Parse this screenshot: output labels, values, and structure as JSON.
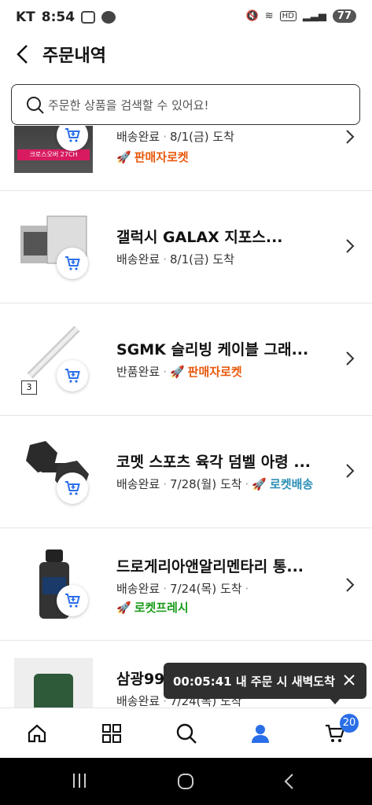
{
  "status_bar": {
    "carrier": "KT",
    "time": "8:54",
    "battery": "77"
  },
  "header": {
    "title": "주문내역"
  },
  "search": {
    "placeholder": "주문한 상품을 검색할 수 있어요!"
  },
  "orders": [
    {
      "name": "",
      "status": "배송완료",
      "date": "8/1(금) 도착",
      "delivery": "판매자로켓",
      "delivery_color": "orange",
      "thumb_text": "크로스오버 27CH"
    },
    {
      "name": "갤럭시 GALAX 지포스...",
      "status": "배송완료",
      "date": "8/1(금) 도착",
      "delivery": ""
    },
    {
      "name": "SGMK 슬리빙 케이블 그래...",
      "status": "반품완료",
      "date": "",
      "delivery": "판매자로켓",
      "delivery_color": "orange",
      "qty": "3"
    },
    {
      "name": "코멧 스포츠 육각 덤벨 아령 ...",
      "status": "배송완료",
      "date": "7/28(월) 도착",
      "delivery": "로켓배송",
      "delivery_color": "blue"
    },
    {
      "name": "드로게리아앤알리멘타리 통...",
      "status": "배송완료",
      "date": "7/24(목) 도착",
      "delivery": "로켓프레시",
      "delivery_color": "green"
    },
    {
      "name": "삼광99",
      "status": "배송완료",
      "date": "7/24(목) 도착",
      "delivery": ""
    }
  ],
  "toast": {
    "text": "00:05:41 내 주문 시 새벽도착"
  },
  "tabbar": {
    "cart_count": "20",
    "icons": [
      "home-icon",
      "category-icon",
      "search-icon",
      "my-icon",
      "cart-icon"
    ]
  },
  "colors": {
    "accent": "#2a6ee8",
    "orange": "#e8590c",
    "blue": "#2b8fb5",
    "green": "#1a9c1a"
  }
}
